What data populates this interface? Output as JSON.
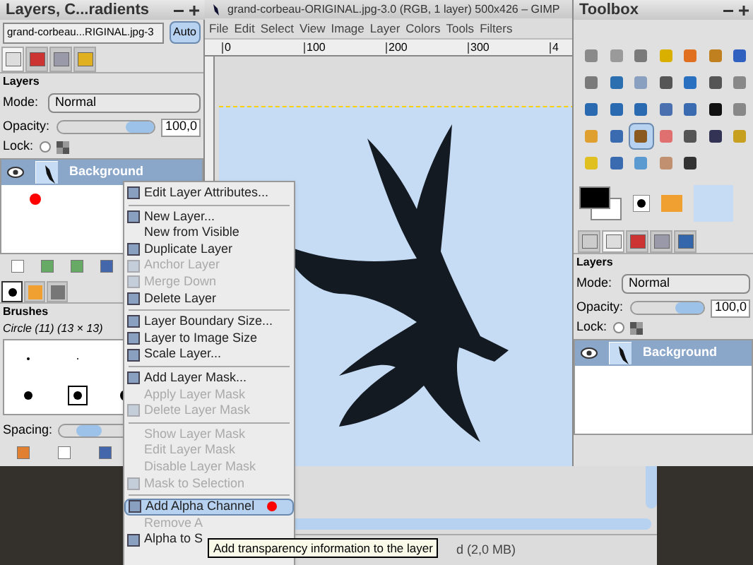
{
  "left_dock": {
    "title": "Layers, C...radients",
    "image_selector": "grand-corbeau...RIGINAL.jpg-3",
    "auto_button": "Auto",
    "tabs": [
      {
        "selected": true
      },
      {
        "selected": false
      },
      {
        "selected": false
      },
      {
        "selected": false
      }
    ],
    "layers": {
      "heading": "Layers",
      "mode_label": "Mode:",
      "mode": "Normal",
      "opacity_label": "Opacity:",
      "opacity": "100,0",
      "level": 1,
      "lock_label": "Lock:",
      "locked": false,
      "marker_dot": true,
      "rows": [
        {
          "name": "Background",
          "selected": true
        }
      ]
    },
    "brush_tabs": [
      {
        "selected": true
      },
      {
        "selected": false
      },
      {
        "selected": false
      }
    ],
    "brushes": {
      "heading": "Brushes",
      "current": "Circle (11) (13 × 13)",
      "spacing_label": "Spacing:",
      "level": 0.15
    }
  },
  "image_window": {
    "title": "grand-corbeau-ORIGINAL.jpg-3.0 (RGB, 1 layer) 500x426 – GIMP",
    "menus": [
      "File",
      "Edit",
      "Select",
      "View",
      "Image",
      "Layer",
      "Colors",
      "Tools",
      "Filters"
    ],
    "ruler_labels": [
      "0",
      "100",
      "200",
      "300",
      "4"
    ],
    "status": "d (2,0 MB)"
  },
  "toolbox": {
    "title": "Toolbox",
    "tools": [
      {
        "selected": false
      },
      {
        "selected": false
      },
      {
        "selected": false
      },
      {
        "selected": false
      },
      {
        "selected": false
      },
      {
        "selected": false
      },
      {
        "selected": false
      },
      {
        "selected": false
      },
      {
        "selected": false
      },
      {
        "selected": false
      },
      {
        "selected": false
      },
      {
        "selected": false
      },
      {
        "selected": false
      },
      {
        "selected": false
      },
      {
        "selected": false
      },
      {
        "selected": false
      },
      {
        "selected": false
      },
      {
        "selected": false
      },
      {
        "selected": false
      },
      {
        "selected": false
      },
      {
        "selected": false
      },
      {
        "selected": false
      },
      {
        "selected": false
      },
      {
        "selected": true
      },
      {
        "selected": false
      },
      {
        "selected": false
      },
      {
        "selected": false
      },
      {
        "selected": false
      },
      {
        "selected": false
      },
      {
        "selected": false
      },
      {
        "selected": false
      },
      {
        "selected": false
      },
      {
        "selected": false
      }
    ],
    "tabs": [
      {
        "selected": false
      },
      {
        "selected": true
      },
      {
        "selected": false
      },
      {
        "selected": false
      },
      {
        "selected": false
      }
    ],
    "layers": {
      "heading": "Layers",
      "mode_label": "Mode:",
      "mode": "Normal",
      "opacity_label": "Opacity:",
      "opacity": "100,0",
      "level": 1,
      "lock_label": "Lock:",
      "locked": false,
      "rows": [
        {
          "name": "Background",
          "selected": true
        }
      ]
    }
  },
  "context_menu": {
    "items": [
      {
        "kind": "item",
        "label": "Edit Layer Attributes...",
        "icon": true,
        "disabled": false,
        "selected": false,
        "marker_dot": false
      },
      {
        "kind": "separator"
      },
      {
        "kind": "item",
        "label": "New Layer...",
        "icon": true,
        "disabled": false,
        "selected": false,
        "marker_dot": false
      },
      {
        "kind": "item",
        "label": "New from Visible",
        "icon": false,
        "disabled": false,
        "selected": false,
        "marker_dot": false
      },
      {
        "kind": "item",
        "label": "Duplicate Layer",
        "icon": true,
        "disabled": false,
        "selected": false,
        "marker_dot": false
      },
      {
        "kind": "item",
        "label": "Anchor Layer",
        "icon": true,
        "disabled": true,
        "selected": false,
        "marker_dot": false
      },
      {
        "kind": "item",
        "label": "Merge Down",
        "icon": true,
        "disabled": true,
        "selected": false,
        "marker_dot": false
      },
      {
        "kind": "item",
        "label": "Delete Layer",
        "icon": true,
        "disabled": false,
        "selected": false,
        "marker_dot": false
      },
      {
        "kind": "separator"
      },
      {
        "kind": "item",
        "label": "Layer Boundary Size...",
        "icon": true,
        "disabled": false,
        "selected": false,
        "marker_dot": false
      },
      {
        "kind": "item",
        "label": "Layer to Image Size",
        "icon": true,
        "disabled": false,
        "selected": false,
        "marker_dot": false
      },
      {
        "kind": "item",
        "label": "Scale Layer...",
        "icon": true,
        "disabled": false,
        "selected": false,
        "marker_dot": false
      },
      {
        "kind": "separator"
      },
      {
        "kind": "item",
        "label": "Add Layer Mask...",
        "icon": true,
        "disabled": false,
        "selected": false,
        "marker_dot": false
      },
      {
        "kind": "item",
        "label": "Apply Layer Mask",
        "icon": false,
        "disabled": true,
        "selected": false,
        "marker_dot": false
      },
      {
        "kind": "item",
        "label": "Delete Layer Mask",
        "icon": true,
        "disabled": true,
        "selected": false,
        "marker_dot": false
      },
      {
        "kind": "separator"
      },
      {
        "kind": "item",
        "label": "Show Layer Mask",
        "icon": false,
        "disabled": true,
        "selected": false,
        "marker_dot": false
      },
      {
        "kind": "item",
        "label": "Edit Layer Mask",
        "icon": false,
        "disabled": true,
        "selected": false,
        "marker_dot": false
      },
      {
        "kind": "item",
        "label": "Disable Layer Mask",
        "icon": false,
        "disabled": true,
        "selected": false,
        "marker_dot": false
      },
      {
        "kind": "item",
        "label": "Mask to Selection",
        "icon": true,
        "disabled": true,
        "selected": false,
        "marker_dot": false
      },
      {
        "kind": "separator"
      },
      {
        "kind": "item",
        "label": "Add Alpha Channel",
        "icon": true,
        "disabled": false,
        "selected": true,
        "marker_dot": true
      },
      {
        "kind": "item",
        "label": "Remove A",
        "icon": false,
        "disabled": true,
        "selected": false,
        "marker_dot": false
      },
      {
        "kind": "item",
        "label": "Alpha to S",
        "icon": true,
        "disabled": false,
        "selected": false,
        "marker_dot": false
      }
    ]
  },
  "tooltip": "Add transparency information to the layer"
}
